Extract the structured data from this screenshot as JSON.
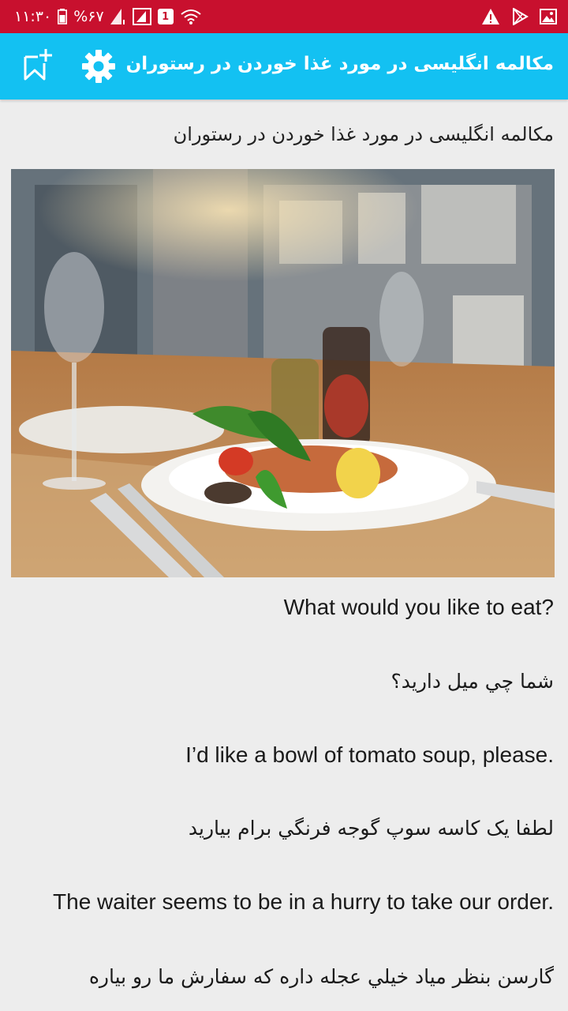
{
  "status_bar": {
    "time": "۱۱:۳۰",
    "battery": "%۶۷",
    "sim_badge": "1",
    "bg_color": "#c8102e"
  },
  "app_bar": {
    "title": "مکالمه انگلیسی در مورد غذا خوردن در رستوران",
    "bg_color": "#13c1f2",
    "icons": [
      "bookmark-add-icon",
      "gear-icon"
    ]
  },
  "content": {
    "heading": "مکالمه انگلیسی در مورد غذا خوردن در رستوران",
    "lines": [
      {
        "lang": "en",
        "text": "What would you like to eat?"
      },
      {
        "lang": "fa",
        "text": "شما چي ميل  داريد؟"
      },
      {
        "lang": "en",
        "text": "I’d like a bowl of tomato soup, please."
      },
      {
        "lang": "fa",
        "text": "لطفا یک کاسه سوپ گوجه فرنگي برام بياريد"
      },
      {
        "lang": "en",
        "text": "The waiter seems to be in a hurry to take our order."
      },
      {
        "lang": "fa",
        "text": "گارسن بنظر مياد خيلي عجله داره که سفارش ما رو بياره"
      }
    ]
  }
}
